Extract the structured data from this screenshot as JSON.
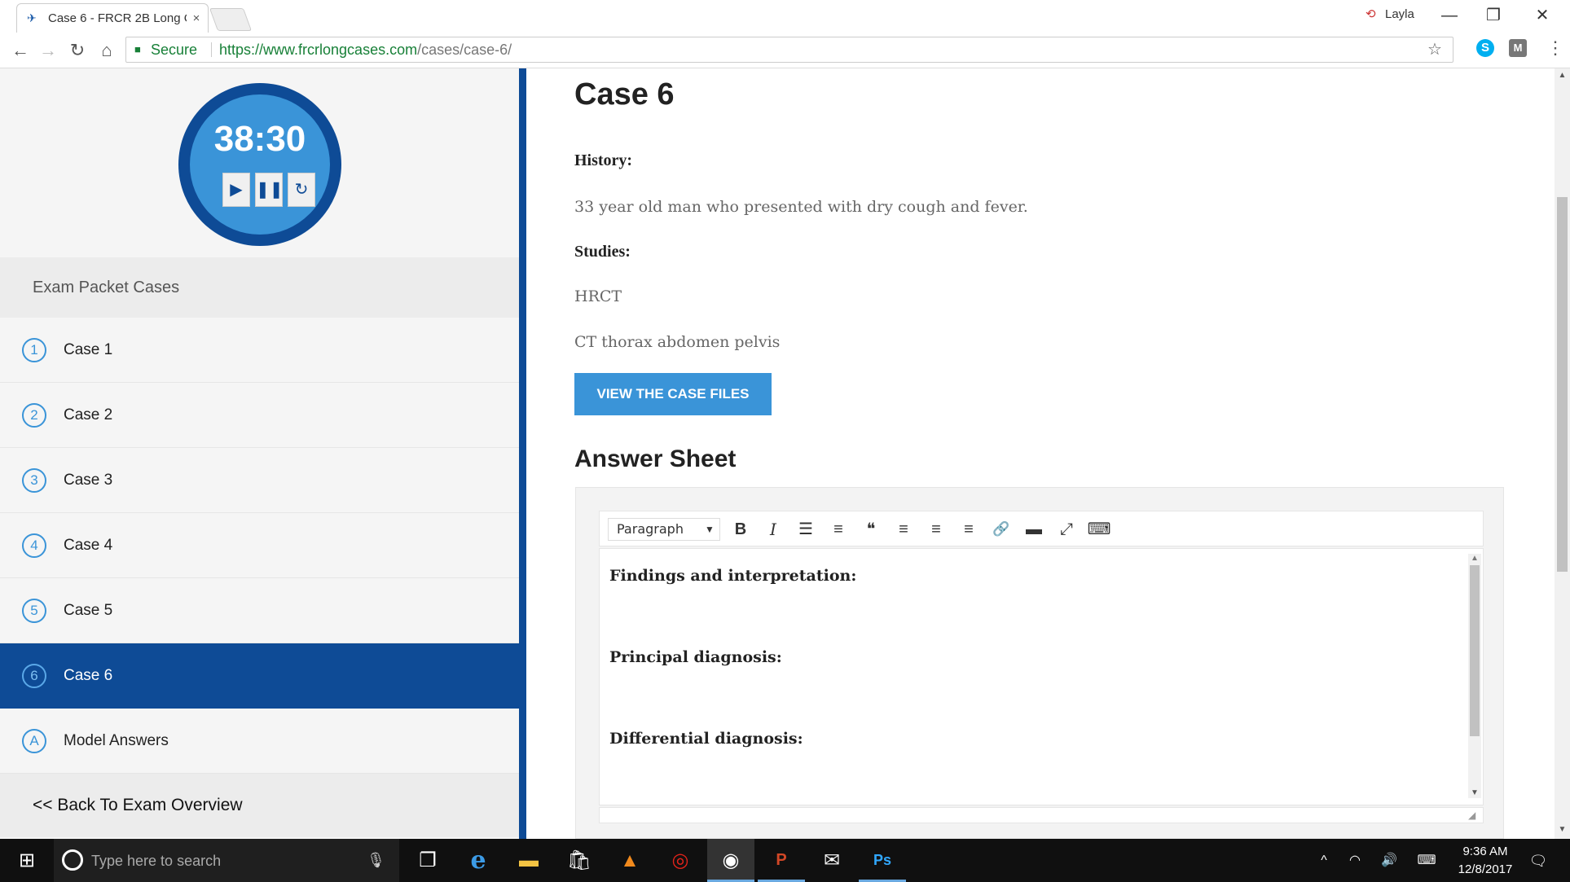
{
  "browser": {
    "tab_title": "Case 6 - FRCR 2B Long C",
    "tab_close": "×",
    "profile_name": "Layla",
    "window_min": "—",
    "window_max": "❐",
    "window_close": "✕",
    "secure_label": "Secure",
    "url_host": "https://www.frcrlongcases.com",
    "url_path": "/cases/case-6/",
    "icons": {
      "back": "←",
      "forward": "→",
      "reload": "↻",
      "home": "⌂",
      "lock": "🔒",
      "star": "☆",
      "menu": "⋮",
      "skype": "S",
      "ext_m": "M"
    }
  },
  "sidebar": {
    "timer": "38:30",
    "timer_buttons": {
      "play": "▶",
      "pause": "❚❚",
      "reset": "↻"
    },
    "packet_title": "Exam Packet Cases",
    "items": [
      {
        "num": "1",
        "label": "Case 1",
        "active": false
      },
      {
        "num": "2",
        "label": "Case 2",
        "active": false
      },
      {
        "num": "3",
        "label": "Case 3",
        "active": false
      },
      {
        "num": "4",
        "label": "Case 4",
        "active": false
      },
      {
        "num": "5",
        "label": "Case 5",
        "active": false
      },
      {
        "num": "6",
        "label": "Case 6",
        "active": true
      },
      {
        "num": "A",
        "label": "Model Answers",
        "active": false
      }
    ],
    "back_label": "<< Back To Exam Overview"
  },
  "main": {
    "title": "Case 6",
    "history_label": "History:",
    "history_text": "33 year old man who presented with dry cough and fever.",
    "studies_label": "Studies:",
    "studies": [
      "HRCT",
      "CT thorax abdomen pelvis"
    ],
    "view_button": "VIEW THE CASE FILES",
    "answer_title": "Answer Sheet"
  },
  "editor": {
    "format_value": "Paragraph",
    "format_caret": "▼",
    "tools": {
      "bold": "B",
      "italic": "I",
      "bullet_list": "☰",
      "numbered_list": "≡",
      "blockquote": "❝",
      "align_left": "≡",
      "align_center": "≡",
      "align_right": "≡",
      "link": "🔗",
      "read_more": "▬",
      "fullscreen": "⤢",
      "kitchen_sink": "⌨"
    },
    "headings": [
      "Findings and interpretation:",
      "Principal diagnosis:",
      "Differential diagnosis:"
    ]
  },
  "taskbar": {
    "start": "⊞",
    "search_placeholder": "Type here to search",
    "mic": "🎙",
    "apps": {
      "taskview": "❐",
      "edge": "e",
      "explorer": "▬",
      "store": "🛍",
      "vlc": "▲",
      "cc": "◎",
      "chrome": "◉",
      "ppt": "P",
      "mail": "✉",
      "ps": "Ps"
    },
    "tray": {
      "chevron": "^",
      "wifi": "◠",
      "volume": "🔊",
      "keyboard": "⌨"
    },
    "time": "9:36 AM",
    "date": "12/8/2017",
    "notifications": "🗨"
  },
  "colors": {
    "accent_dark": "#0e4b96",
    "accent_light": "#3a94d8",
    "secure_green": "#188038"
  }
}
